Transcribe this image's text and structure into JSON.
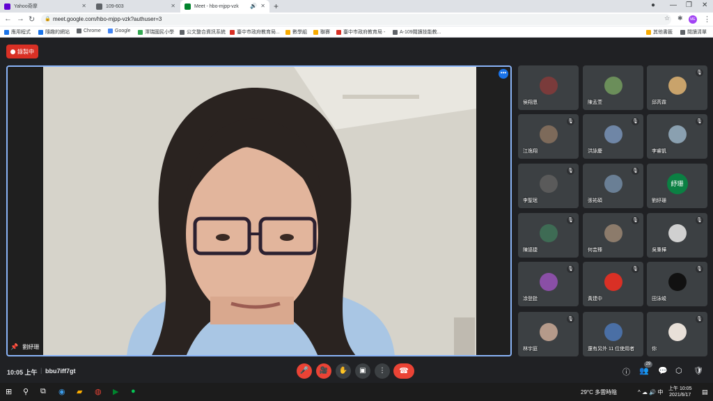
{
  "browser": {
    "tabs": [
      {
        "title": "Yahoo奇摩",
        "color": "#6001d2"
      },
      {
        "title": "109-603",
        "color": "#5f6368"
      },
      {
        "title": "Meet - hbo-mjpp-vzk",
        "color": "#00832d"
      }
    ],
    "new_tab": "+",
    "url": "meet.google.com/hbo-mjpp-vzk?authuser=3",
    "bookmarks": [
      "應用程式",
      "隨趣的網站",
      "Chrome",
      "Google",
      "澤瑞國民小學",
      "公文整合資訊系統",
      "臺中市政府教育局...",
      "數學組",
      "聯賽",
      "臺中市政府教育局 -",
      "A-109閱讀技能教..."
    ],
    "bookmarks_right": [
      "其他書籤",
      "閱讀清單"
    ],
    "profile": "ME"
  },
  "meet": {
    "recording_label": "錄製中",
    "main_speaker": "劉紓珊",
    "participants": [
      {
        "name": "侯翔恩",
        "muted": false,
        "av": "#7a3b3b"
      },
      {
        "name": "陳孟萱",
        "muted": false,
        "av": "#6b8e5a"
      },
      {
        "name": "邱芮霖",
        "muted": true,
        "av": "#c9a36b"
      },
      {
        "name": "江逸翔",
        "muted": true,
        "av": "#7d6a5a"
      },
      {
        "name": "洪詠慶",
        "muted": true,
        "av": "#6f86a6"
      },
      {
        "name": "李睿凱",
        "muted": true,
        "av": "#8aa0b0"
      },
      {
        "name": "李聖珉",
        "muted": true,
        "av": "#5a5a5a"
      },
      {
        "name": "張祐碩",
        "muted": true,
        "av": "#6a7f95"
      },
      {
        "name": "劉紓珊",
        "muted": false,
        "av": "#0b8043",
        "initials": "紓珊"
      },
      {
        "name": "陳語捷",
        "muted": true,
        "av": "#3e6b54"
      },
      {
        "name": "何芸臻",
        "muted": true,
        "av": "#8c7b6b"
      },
      {
        "name": "吳秉樺",
        "muted": true,
        "av": "#d0d0d0"
      },
      {
        "name": "凃登銓",
        "muted": true,
        "av": "#8a4fa6"
      },
      {
        "name": "黃建中",
        "muted": true,
        "av": "#d93025"
      },
      {
        "name": "田泳峻",
        "muted": true,
        "av": "#111111"
      },
      {
        "name": "林宇庭",
        "muted": true,
        "av": "#b59a8a"
      },
      {
        "name": "還有另外 11 位使用者",
        "muted": false,
        "av": "#4a6fa5"
      },
      {
        "name": "你",
        "muted": true,
        "av": "#e8e0d8"
      }
    ],
    "clock": "10:05 上午",
    "meeting_code": "bbu7iff7gt",
    "participant_count": "29"
  },
  "taskbar": {
    "weather": "29°C 多雲時陰",
    "time": "上午 10:05",
    "date": "2021/6/17"
  }
}
